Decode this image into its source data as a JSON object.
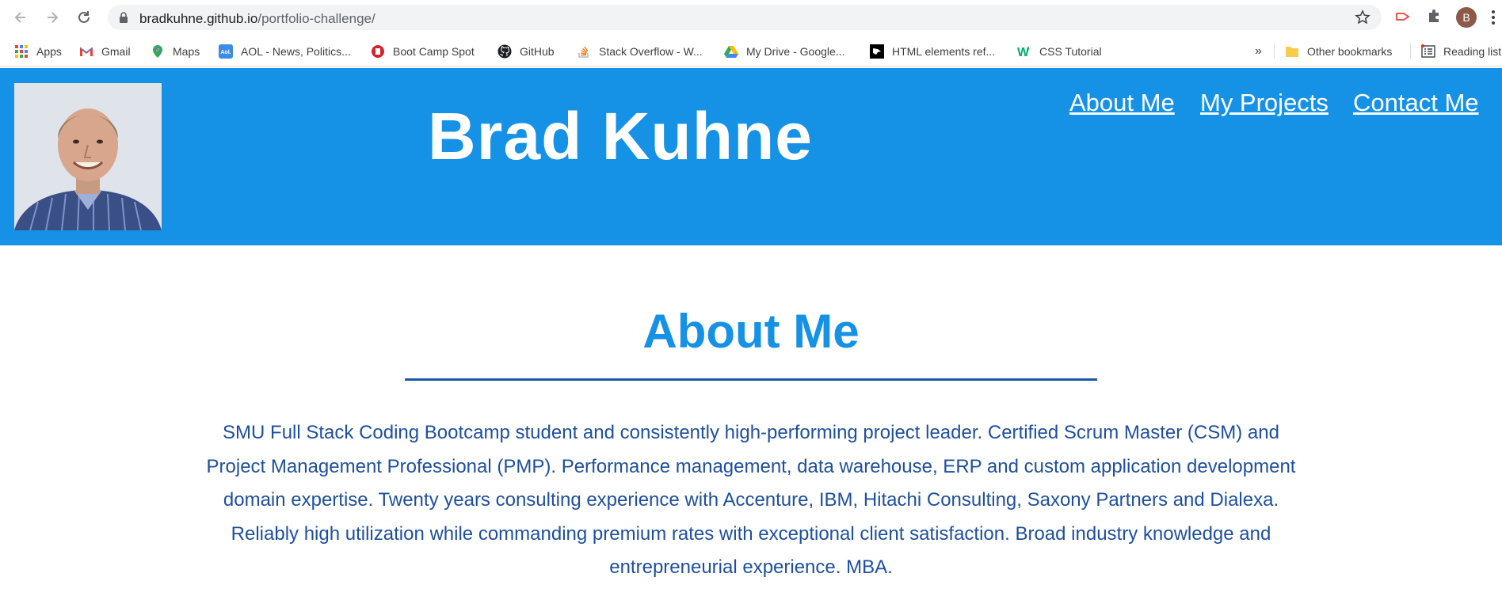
{
  "browser": {
    "url_domain": "bradkuhne.github.io",
    "url_path": "/portfolio-challenge/",
    "profile_initial": "B",
    "bookmarks": [
      {
        "label": "Apps",
        "icon": "apps-grid-icon"
      },
      {
        "label": "Gmail",
        "icon": "gmail-icon"
      },
      {
        "label": "Maps",
        "icon": "maps-pin-icon"
      },
      {
        "label": "AOL - News, Politics...",
        "icon": "aol-icon"
      },
      {
        "label": "Boot Camp Spot",
        "icon": "bootcampspot-icon"
      },
      {
        "label": "GitHub",
        "icon": "github-icon"
      },
      {
        "label": "Stack Overflow - W...",
        "icon": "stackoverflow-icon"
      },
      {
        "label": "My Drive - Google...",
        "icon": "google-drive-icon"
      },
      {
        "label": "HTML elements ref...",
        "icon": "mdn-icon"
      },
      {
        "label": "CSS Tutorial",
        "icon": "w3schools-icon"
      }
    ],
    "overflow_label": "»",
    "other_bookmarks": "Other bookmarks",
    "reading_list": "Reading list"
  },
  "site": {
    "name": "Brad Kuhne",
    "nav": [
      "About Me",
      "My Projects",
      "Contact Me"
    ],
    "header_color": "#1591e6"
  },
  "about": {
    "title": "About Me",
    "text": "SMU Full Stack Coding Bootcamp student and consistently high-performing project leader. Certified Scrum Master (CSM) and Project Management Professional (PMP). Performance management, data warehouse, ERP and custom application development domain expertise. Twenty years consulting experience with Accenture, IBM, Hitachi Consulting, Saxony Partners and Dialexa. Reliably high utilization while commanding premium rates with exceptional client satisfaction. Broad industry knowledge and entrepreneurial experience. MBA."
  }
}
